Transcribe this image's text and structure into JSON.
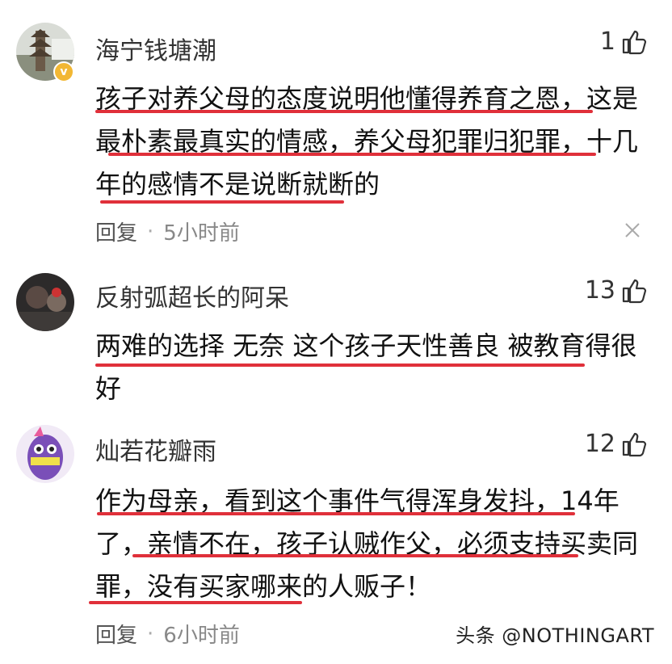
{
  "comments": [
    {
      "username": "海宁钱塘潮",
      "likes": "1",
      "lines": [
        "孩子对养父母的态度说明他懂得养育之恩，这是",
        "最朴素最真实的情感，养父母犯罪归犯罪，十几",
        "年的感情不是说断就断的"
      ],
      "reply_label": "回复",
      "time": "5小时前"
    },
    {
      "username": "反射弧超长的阿呆",
      "likes": "13",
      "lines": [
        "两难的选择 无奈 这个孩子天性善良 被教育得很",
        "好"
      ]
    },
    {
      "username": "灿若花瓣雨",
      "likes": "12",
      "lines": [
        "作为母亲，看到这个事件气得浑身发抖，14年",
        "了，亲情不在，孩子认贼作父，必须支持买卖同",
        "罪，没有买家哪来的人贩子！"
      ],
      "reply_label": "回复",
      "time": "6小时前"
    }
  ],
  "watermark": "头条 @NOTHINGART",
  "colors": {
    "underline": "#e0303a",
    "verified_badge": "#f2b733"
  },
  "icons": {
    "like": "thumbs-up-icon",
    "close": "close-icon",
    "verified": "verified-badge-icon"
  }
}
